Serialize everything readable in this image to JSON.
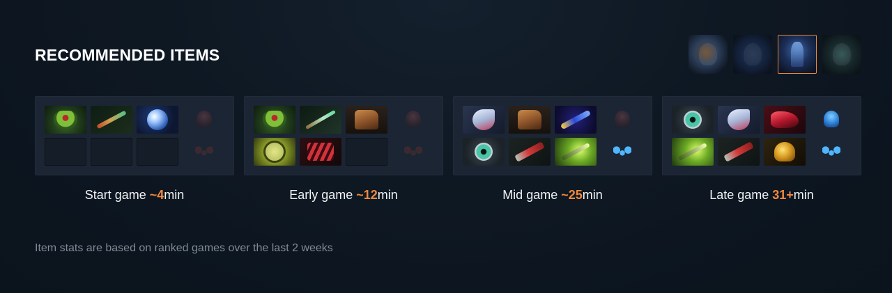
{
  "section": {
    "title": "RECOMMENDED ITEMS"
  },
  "heroes": [
    {
      "name": "hero-1",
      "selected": false
    },
    {
      "name": "hero-2",
      "selected": false
    },
    {
      "name": "hero-3",
      "selected": true
    },
    {
      "name": "hero-4",
      "selected": false
    }
  ],
  "phases": [
    {
      "label_prefix": "Start game ",
      "time": "~4",
      "label_suffix": "min",
      "items": [
        "wraith-band-icon",
        "magic-stick-icon",
        "blue-orb-icon",
        "empty",
        "empty",
        "empty"
      ],
      "neutral_active": false
    },
    {
      "label_prefix": "Early game ",
      "time": "~12",
      "label_suffix": "min",
      "items": [
        "wraith-band-icon",
        "magic-wand-icon",
        "boots-icon",
        "aura-ring-icon",
        "red-claw-icon",
        "empty"
      ],
      "neutral_active": false
    },
    {
      "label_prefix": "Mid game ",
      "time": "~25",
      "label_suffix": "min",
      "items": [
        "axe-icon",
        "boots-icon",
        "blue-dagger-icon",
        "eye-skull-icon",
        "spear-icon",
        "glowing-blade-icon"
      ],
      "neutral_active": true
    },
    {
      "label_prefix": "Late game ",
      "time": "31+",
      "label_suffix": "min",
      "items": [
        "eye-skull-icon",
        "axe-icon",
        "dragon-lance-icon",
        "glowing-blade-icon",
        "spear-icon",
        "golden-helm-icon"
      ],
      "neutral_active": true
    }
  ],
  "footnote": "Item stats are based on ranked games over the last 2 weeks",
  "colors": {
    "accent": "#f0883e",
    "panel": "#1b2533",
    "background": "#0e1823"
  }
}
